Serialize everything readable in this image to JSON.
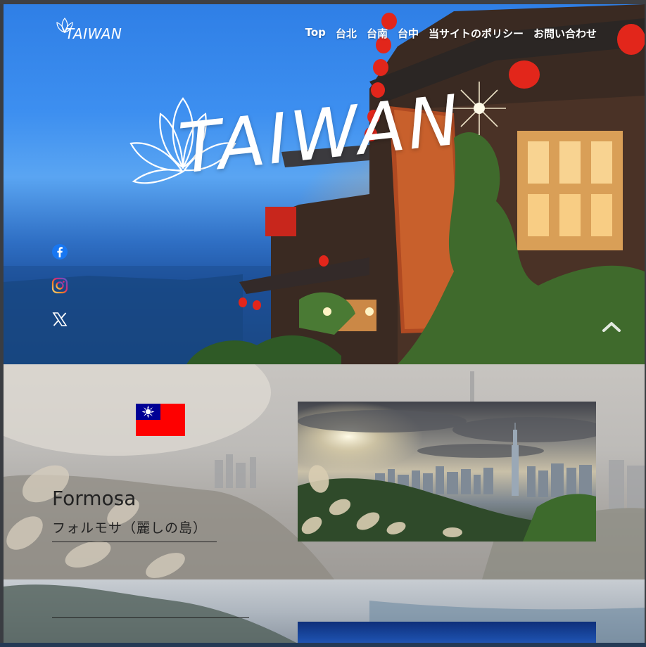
{
  "brand": {
    "logo_text": "TAIWAN"
  },
  "nav": {
    "items": [
      {
        "label": "Top"
      },
      {
        "label": "台北"
      },
      {
        "label": "台南"
      },
      {
        "label": "台中"
      },
      {
        "label": "当サイトのポリシー"
      },
      {
        "label": "お問い合わせ"
      }
    ]
  },
  "hero": {
    "logo_text": "TAIWAN"
  },
  "social": {
    "icons": [
      "facebook-icon",
      "instagram-icon",
      "x-icon"
    ]
  },
  "section_formosa": {
    "flag_icon": "taiwan-flag-icon",
    "title_en": "Formosa",
    "title_ja": "フォルモサ（麗しの島）"
  },
  "colors": {
    "nav_text": "#ffffff",
    "heading_text": "#222222",
    "sky_blue": "#3d8ff0",
    "flag_red": "#fe0000",
    "flag_blue": "#000095"
  }
}
